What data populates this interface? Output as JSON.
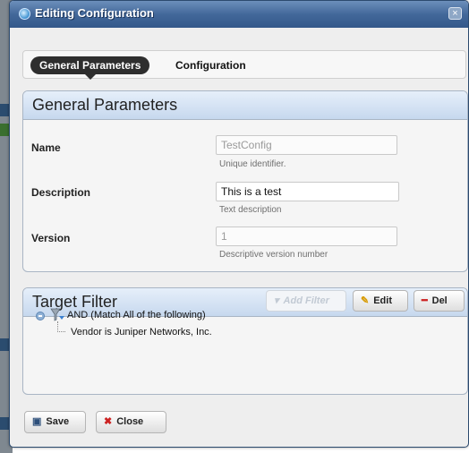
{
  "window": {
    "title": "Editing Configuration",
    "close_glyph": "×"
  },
  "tabs": [
    {
      "label": "General Parameters",
      "active": true
    },
    {
      "label": "Configuration",
      "active": false
    }
  ],
  "general_parameters": {
    "heading": "General Parameters",
    "fields": [
      {
        "label": "Name",
        "value": "TestConfig",
        "hint": "Unique identifier.",
        "disabled": true
      },
      {
        "label": "Description",
        "value": "This is a test",
        "hint": "Text description",
        "disabled": false
      },
      {
        "label": "Version",
        "value": "1",
        "hint": "Descriptive version number",
        "disabled": true
      }
    ]
  },
  "target_filter": {
    "heading": "Target Filter",
    "add_filter_label": "Add Filter",
    "edit_label": "Edit",
    "del_label": "Del",
    "tree": {
      "root": "AND (Match All of the following)",
      "children": [
        "Vendor is Juniper Networks, Inc."
      ]
    }
  },
  "footer": {
    "save_label": "Save",
    "close_label": "Close"
  },
  "colors": {
    "titlebar": "#43689a",
    "panel_header": "#c6d8ee",
    "active_tab": "#2e2e2e",
    "del_accent": "#cc2222",
    "close_accent": "#cc2222"
  },
  "icons": [
    "app-icon",
    "close-icon",
    "pencil-icon",
    "minus-icon",
    "filter-icon",
    "save-disk-icon",
    "x-icon"
  ]
}
